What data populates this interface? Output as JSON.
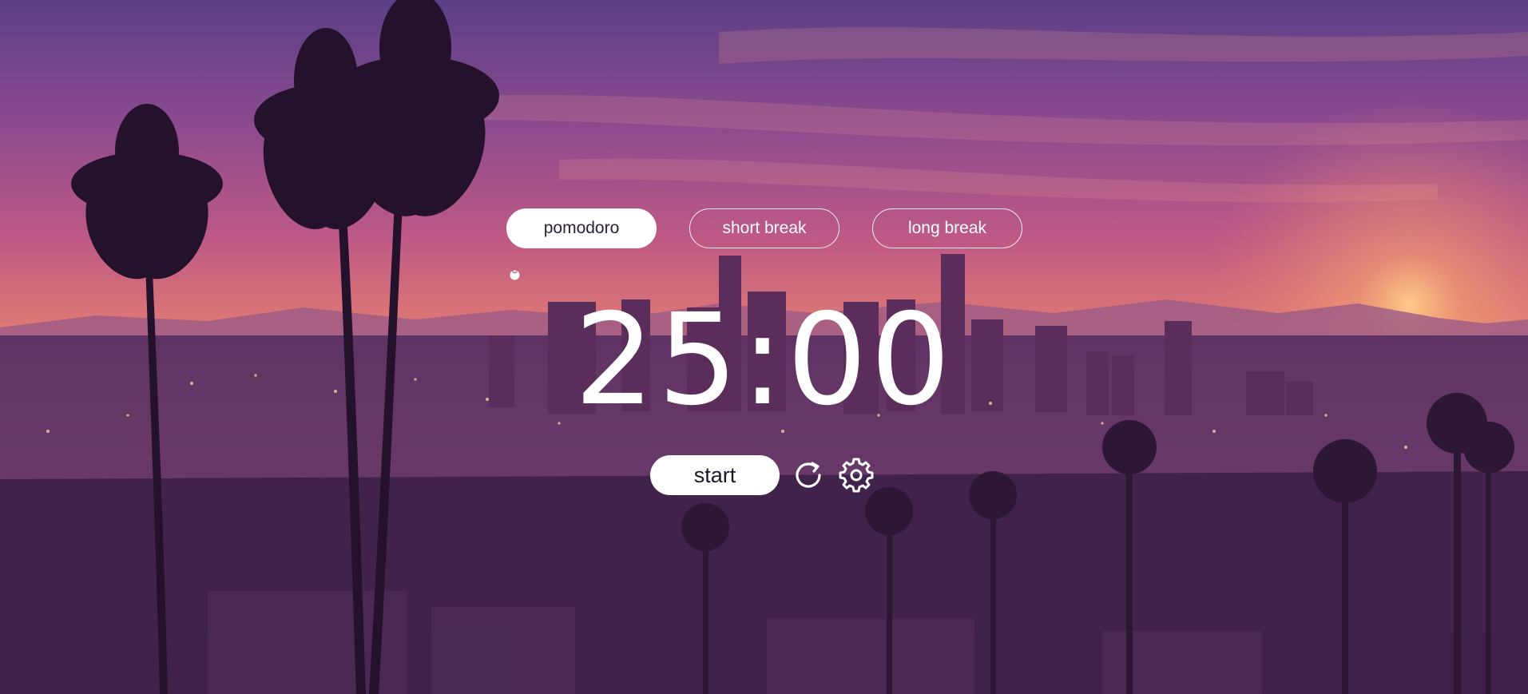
{
  "modes": [
    {
      "label": "pomodoro",
      "active": true
    },
    {
      "label": "short break",
      "active": false
    },
    {
      "label": "long break",
      "active": false
    }
  ],
  "timer": {
    "display": "25:00"
  },
  "controls": {
    "start_label": "start",
    "reset_icon": "reset-icon",
    "settings_icon": "gear-icon"
  },
  "session_indicator_icon": "tomato-icon",
  "background": {
    "description_icon": "sunset-cityscape-image"
  },
  "colors": {
    "accent": "#ffffff",
    "text_dark": "#2a1f3a"
  }
}
